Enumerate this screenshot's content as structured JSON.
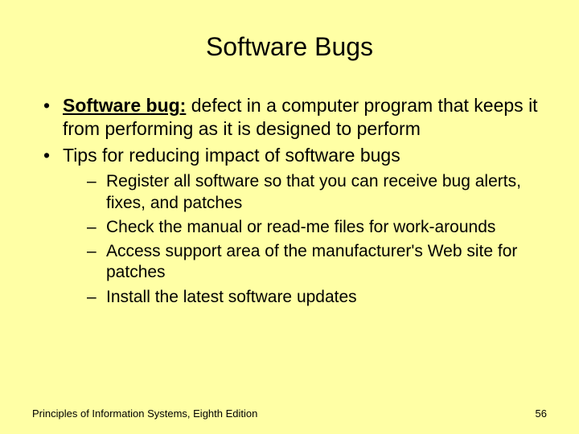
{
  "title": "Software Bugs",
  "bullets": {
    "b1_term": "Software bug:",
    "b1_rest": " defect in a computer program that keeps it from performing as it is designed to perform",
    "b2": "Tips for reducing impact of software bugs",
    "sub": {
      "s1": "Register all software so that you can receive bug alerts, fixes, and patches",
      "s2": "Check the manual or read-me files for work-arounds",
      "s3": "Access support area of the manufacturer's Web site for patches",
      "s4": "Install the latest software updates"
    }
  },
  "footer": {
    "source": "Principles of Information Systems, Eighth Edition",
    "page": "56"
  }
}
